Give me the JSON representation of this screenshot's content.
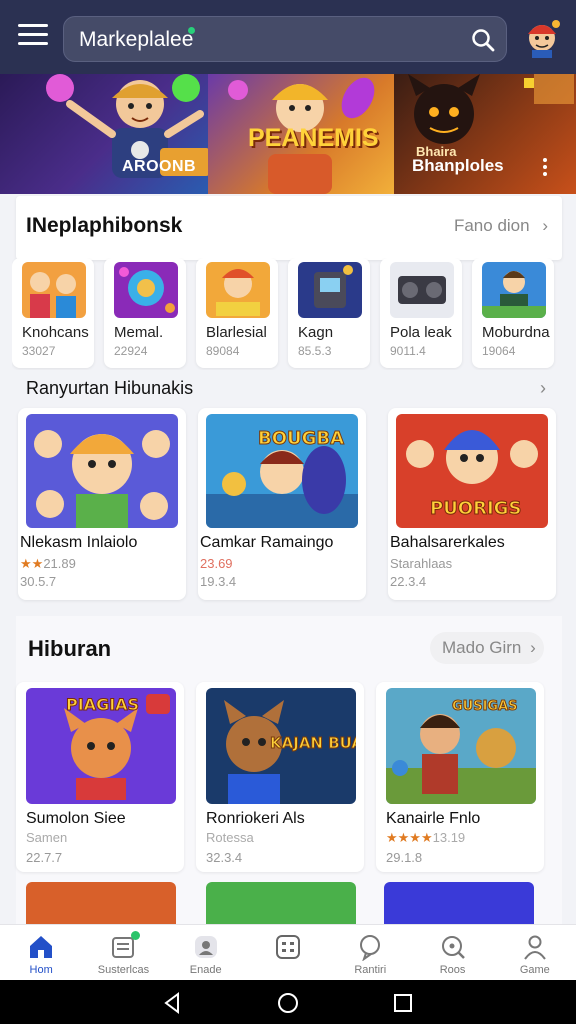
{
  "search": {
    "placeholder": "Markeplalee"
  },
  "banners": [
    {
      "title": "AROONB"
    },
    {
      "title": "PEANEMIS"
    },
    {
      "small": "Bhaira",
      "title": "Bhanploles"
    }
  ],
  "section1": {
    "title": "INeplaphibonsk",
    "more": "Fano dion"
  },
  "small_apps": [
    {
      "name": "Knohcans",
      "meta": "33027"
    },
    {
      "name": "Memal.",
      "meta": "22924"
    },
    {
      "name": "Blarlesial",
      "meta": "89084"
    },
    {
      "name": "Kagn",
      "meta": "85.5.3"
    },
    {
      "name": "Pola leak",
      "meta": "9011.4"
    },
    {
      "name": "Moburdna",
      "meta": "19064"
    }
  ],
  "section2": {
    "title": "Ranyurtan Hibunakis"
  },
  "mid_apps": [
    {
      "name": "Nlekasm Inlaiolo",
      "stars": "★★",
      "rating": "21.89",
      "size": "30.5.7",
      "art": ""
    },
    {
      "name": "Camkar Ramaingo",
      "stars": "",
      "rating": "23.69",
      "size": "19.3.4",
      "art": "BOUGBA"
    },
    {
      "name": "Bahalsarerkales",
      "stars": "",
      "rating": "Starahlaas",
      "size": "22.3.4",
      "art": "PUORIGS"
    }
  ],
  "hiburan": {
    "title": "Hiburan",
    "more": "Mado Girn",
    "apps": [
      {
        "name": "Sumolon Siee",
        "stars": "",
        "rating": "Samen",
        "size": "22.7.7",
        "art": "PIAGIAS"
      },
      {
        "name": "Ronriokeri Als",
        "stars": "",
        "rating": "Rotessa",
        "size": "32.3.4",
        "art": "KAJAN BUANES"
      },
      {
        "name": "Kanairle Fnlo",
        "stars": "★★★★",
        "rating": "13.19",
        "size": "29.1.8",
        "art": "GUSIGAS"
      }
    ]
  },
  "bottom_nav": [
    {
      "label": "Hom"
    },
    {
      "label": "Susterlcas"
    },
    {
      "label": "Enade"
    },
    {
      "label": ""
    },
    {
      "label": "Rantiri"
    },
    {
      "label": "Roos"
    },
    {
      "label": "Game"
    }
  ],
  "colors": {
    "topbar": "#2b3152",
    "accent": "#2350c8",
    "badge": "#2cc46b",
    "star": "#e07b22"
  }
}
